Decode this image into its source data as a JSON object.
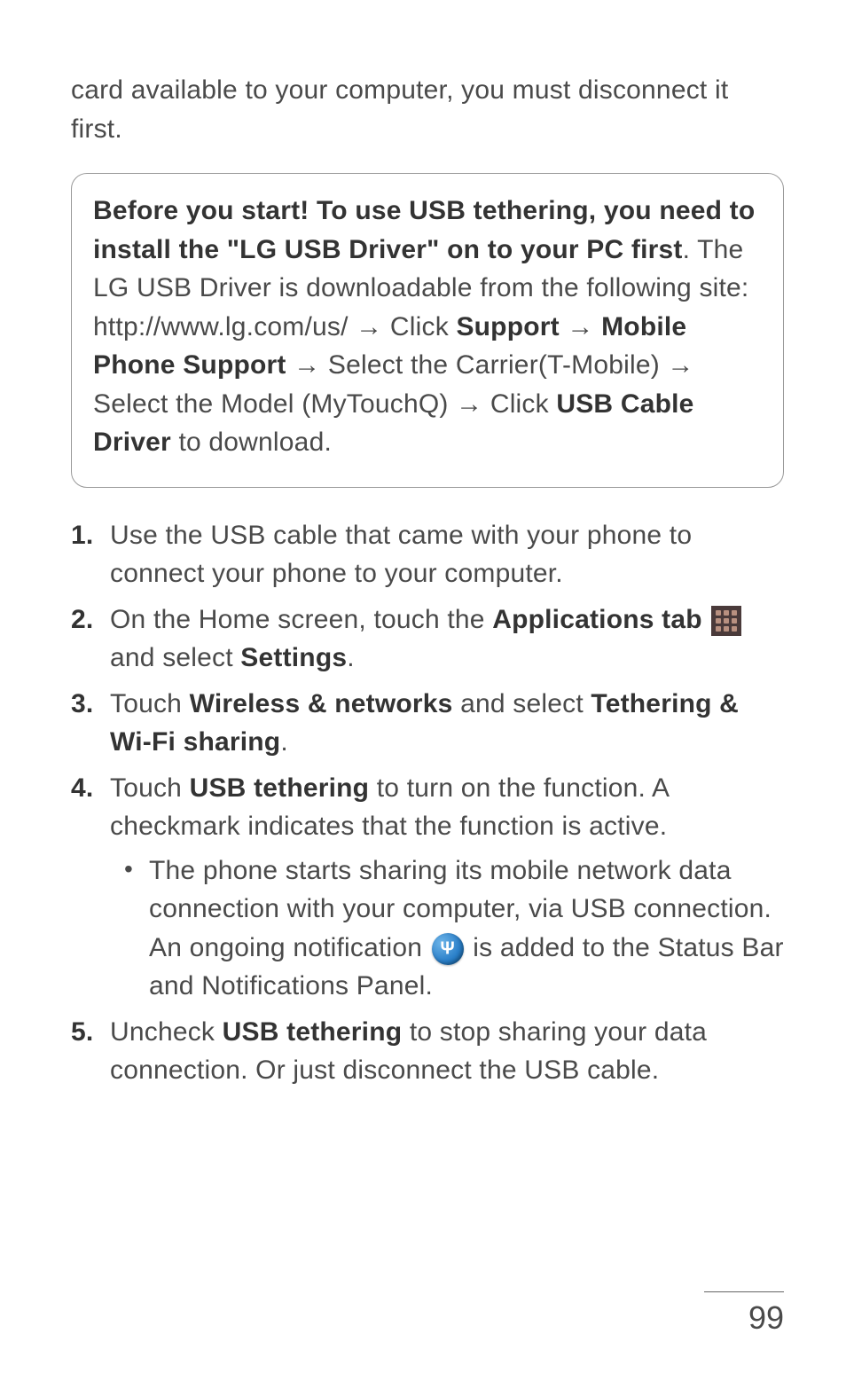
{
  "intro": "card available to your computer, you must disconnect it first.",
  "note": {
    "bold1": "Before you start! To use USB tethering, you need to install the \"LG USB Driver\" on to your PC first",
    "text1": ". The LG USB Driver is downloadable from the following site: http://www.lg.com/us/ → Click ",
    "bold2": "Support",
    "text2": " → ",
    "bold3": "Mobile Phone Support",
    "text3": " → Select the Carrier(T-Mobile) → Select the Model (MyTouchQ) → Click ",
    "bold4": "USB Cable Driver",
    "text4": " to download."
  },
  "steps": {
    "s1": "Use the USB cable that came with your phone to connect your phone to your computer.",
    "s2a": "On the Home screen, touch the ",
    "s2b": "Applications tab",
    "s2c": " and select ",
    "s2d": "Settings",
    "s2e": ".",
    "s3a": "Touch ",
    "s3b": "Wireless & networks",
    "s3c": " and select ",
    "s3d": "Tethering & Wi-Fi sharing",
    "s3e": ".",
    "s4a": "Touch ",
    "s4b": "USB tethering",
    "s4c": " to turn on the function. A checkmark indicates that the function is active.",
    "s4bul1": "The phone starts sharing its mobile network data connection with your computer, via USB connection. An ongoing notification ",
    "s4bul2": " is added to the Status Bar and Notifications Panel.",
    "s5a": "Uncheck ",
    "s5b": "USB tethering",
    "s5c": " to stop sharing your data connection. Or just disconnect the USB cable."
  },
  "pageNumber": "99"
}
